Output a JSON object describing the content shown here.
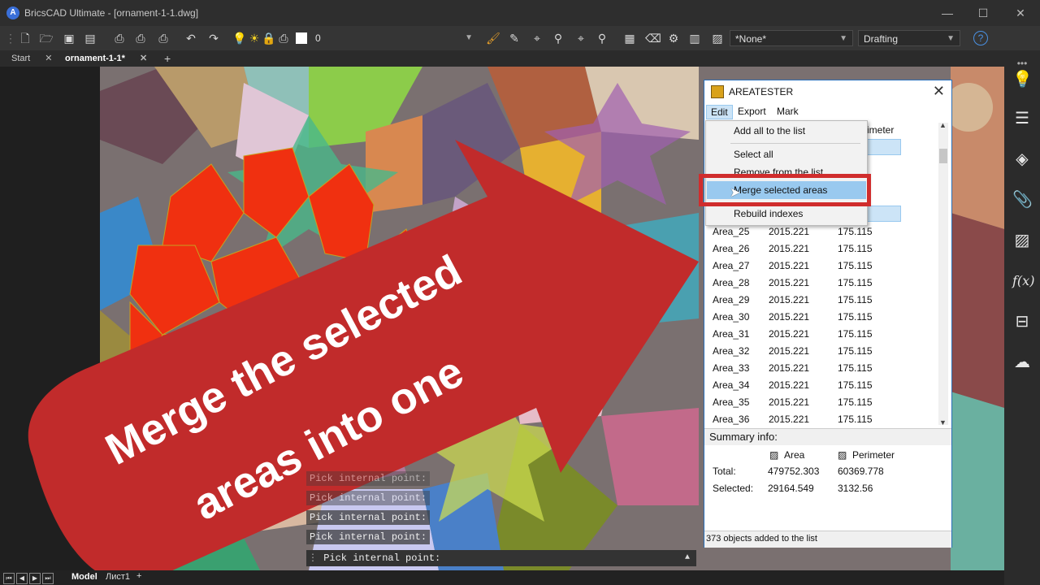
{
  "window": {
    "title": "BricsCAD Ultimate - [ornament-1-1.dwg]",
    "logo": "A",
    "minimize_icon": "—",
    "maximize_icon": "☐",
    "close_icon": "✕"
  },
  "toolbar": {
    "layer_value": "0",
    "style_value": "*None*",
    "workspace_value": "Drafting",
    "help_icon": "?"
  },
  "tabs": [
    {
      "label": "Start"
    },
    {
      "label": "ornament-1-1*"
    }
  ],
  "tab_add": "+",
  "tab_close": "✕",
  "command": {
    "history": [
      "Pick internal point:",
      "Pick internal point:",
      "Pick internal point:",
      "Pick internal point:"
    ],
    "prompt": "Pick internal point:"
  },
  "statusbar": {
    "model_tab": "Model",
    "layout_tab": "Лист1",
    "add": "+"
  },
  "overlay": {
    "line1": "Merge the selected",
    "line2": "areas into one"
  },
  "dialog": {
    "title": "AREATESTER",
    "menu": [
      "Edit",
      "Export",
      "Mark"
    ],
    "header_partial": "imeter",
    "rows": [
      {
        "name": "Area_25",
        "area": "2015.221",
        "perimeter": "175.115"
      },
      {
        "name": "Area_26",
        "area": "2015.221",
        "perimeter": "175.115"
      },
      {
        "name": "Area_27",
        "area": "2015.221",
        "perimeter": "175.115"
      },
      {
        "name": "Area_28",
        "area": "2015.221",
        "perimeter": "175.115"
      },
      {
        "name": "Area_29",
        "area": "2015.221",
        "perimeter": "175.115"
      },
      {
        "name": "Area_30",
        "area": "2015.221",
        "perimeter": "175.115"
      },
      {
        "name": "Area_31",
        "area": "2015.221",
        "perimeter": "175.115"
      },
      {
        "name": "Area_32",
        "area": "2015.221",
        "perimeter": "175.115"
      },
      {
        "name": "Area_33",
        "area": "2015.221",
        "perimeter": "175.115"
      },
      {
        "name": "Area_34",
        "area": "2015.221",
        "perimeter": "175.115"
      },
      {
        "name": "Area_35",
        "area": "2015.221",
        "perimeter": "175.115"
      },
      {
        "name": "Area_36",
        "area": "2015.221",
        "perimeter": "175.115"
      }
    ],
    "summary_label": "Summary info:",
    "col_area": "Area",
    "col_perimeter": "Perimeter",
    "total_label": "Total:",
    "total_area": "479752.303",
    "total_perimeter": "60369.778",
    "selected_label": "Selected:",
    "selected_area": "29164.549",
    "selected_perimeter": "3132.56",
    "status": "373 objects added to the list"
  },
  "edit_menu": {
    "items": [
      {
        "label": "Add all to the list"
      },
      {
        "label": "Select all"
      },
      {
        "label": "Remove from the list"
      },
      {
        "label": "Merge selected areas"
      },
      {
        "label": "Rebuild indexes"
      }
    ]
  },
  "colors": {
    "accent": "#2a6fb8",
    "highlight": "#99c9ef",
    "arrow": "#c12b2b",
    "selected_region": "#f03010"
  }
}
